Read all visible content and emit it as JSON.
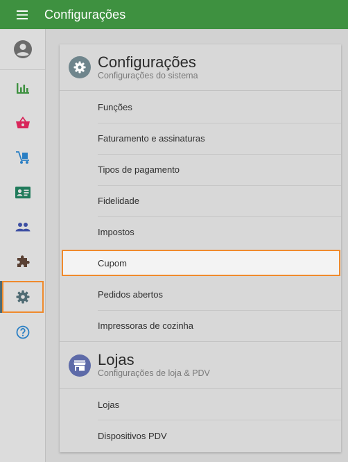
{
  "header": {
    "title": "Configurações",
    "menu_icon": "hamburger-menu-icon",
    "bar_color": "#3e9140"
  },
  "rail": {
    "items": [
      {
        "name": "profile",
        "icon": "account-circle-icon",
        "color": "#6b6b6b"
      },
      {
        "name": "reports",
        "icon": "bar-chart-icon",
        "color": "#3e9140"
      },
      {
        "name": "sales",
        "icon": "shopping-basket-icon",
        "color": "#d8265a"
      },
      {
        "name": "delivery",
        "icon": "hand-truck-icon",
        "color": "#2a7fc4"
      },
      {
        "name": "customers",
        "icon": "contact-card-icon",
        "color": "#1f7a5a"
      },
      {
        "name": "users",
        "icon": "people-icon",
        "color": "#3d4fa3"
      },
      {
        "name": "extensions",
        "icon": "puzzle-piece-icon",
        "color": "#5a4134"
      },
      {
        "name": "settings",
        "icon": "gear-icon",
        "color": "#4f6b73",
        "active": true
      },
      {
        "name": "help",
        "icon": "help-circle-icon",
        "color": "#2a7fc4"
      }
    ]
  },
  "settings_section": {
    "title": "Configurações",
    "subtitle": "Configurações do sistema",
    "icon": "gear-icon",
    "icon_bg": "#6f858c",
    "items": [
      "Funções",
      "Faturamento e assinaturas",
      "Tipos de pagamento",
      "Fidelidade",
      "Impostos",
      "Cupom",
      "Pedidos abertos",
      "Impressoras de cozinha"
    ],
    "selected": "Cupom"
  },
  "stores_section": {
    "title": "Lojas",
    "subtitle": "Configurações de loja & PDV",
    "icon": "storefront-icon",
    "icon_bg": "#5d6aa8",
    "items": [
      "Lojas",
      "Dispositivos PDV"
    ]
  },
  "accent_color": "#ef8a2c"
}
